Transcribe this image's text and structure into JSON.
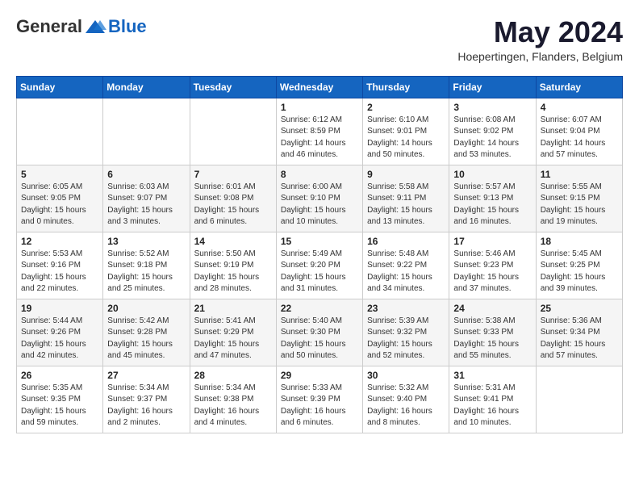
{
  "header": {
    "logo_general": "General",
    "logo_blue": "Blue",
    "month_title": "May 2024",
    "location": "Hoepertingen, Flanders, Belgium"
  },
  "weekdays": [
    "Sunday",
    "Monday",
    "Tuesday",
    "Wednesday",
    "Thursday",
    "Friday",
    "Saturday"
  ],
  "weeks": [
    [
      {
        "day": "",
        "info": ""
      },
      {
        "day": "",
        "info": ""
      },
      {
        "day": "",
        "info": ""
      },
      {
        "day": "1",
        "info": "Sunrise: 6:12 AM\nSunset: 8:59 PM\nDaylight: 14 hours\nand 46 minutes."
      },
      {
        "day": "2",
        "info": "Sunrise: 6:10 AM\nSunset: 9:01 PM\nDaylight: 14 hours\nand 50 minutes."
      },
      {
        "day": "3",
        "info": "Sunrise: 6:08 AM\nSunset: 9:02 PM\nDaylight: 14 hours\nand 53 minutes."
      },
      {
        "day": "4",
        "info": "Sunrise: 6:07 AM\nSunset: 9:04 PM\nDaylight: 14 hours\nand 57 minutes."
      }
    ],
    [
      {
        "day": "5",
        "info": "Sunrise: 6:05 AM\nSunset: 9:05 PM\nDaylight: 15 hours\nand 0 minutes."
      },
      {
        "day": "6",
        "info": "Sunrise: 6:03 AM\nSunset: 9:07 PM\nDaylight: 15 hours\nand 3 minutes."
      },
      {
        "day": "7",
        "info": "Sunrise: 6:01 AM\nSunset: 9:08 PM\nDaylight: 15 hours\nand 6 minutes."
      },
      {
        "day": "8",
        "info": "Sunrise: 6:00 AM\nSunset: 9:10 PM\nDaylight: 15 hours\nand 10 minutes."
      },
      {
        "day": "9",
        "info": "Sunrise: 5:58 AM\nSunset: 9:11 PM\nDaylight: 15 hours\nand 13 minutes."
      },
      {
        "day": "10",
        "info": "Sunrise: 5:57 AM\nSunset: 9:13 PM\nDaylight: 15 hours\nand 16 minutes."
      },
      {
        "day": "11",
        "info": "Sunrise: 5:55 AM\nSunset: 9:15 PM\nDaylight: 15 hours\nand 19 minutes."
      }
    ],
    [
      {
        "day": "12",
        "info": "Sunrise: 5:53 AM\nSunset: 9:16 PM\nDaylight: 15 hours\nand 22 minutes."
      },
      {
        "day": "13",
        "info": "Sunrise: 5:52 AM\nSunset: 9:18 PM\nDaylight: 15 hours\nand 25 minutes."
      },
      {
        "day": "14",
        "info": "Sunrise: 5:50 AM\nSunset: 9:19 PM\nDaylight: 15 hours\nand 28 minutes."
      },
      {
        "day": "15",
        "info": "Sunrise: 5:49 AM\nSunset: 9:20 PM\nDaylight: 15 hours\nand 31 minutes."
      },
      {
        "day": "16",
        "info": "Sunrise: 5:48 AM\nSunset: 9:22 PM\nDaylight: 15 hours\nand 34 minutes."
      },
      {
        "day": "17",
        "info": "Sunrise: 5:46 AM\nSunset: 9:23 PM\nDaylight: 15 hours\nand 37 minutes."
      },
      {
        "day": "18",
        "info": "Sunrise: 5:45 AM\nSunset: 9:25 PM\nDaylight: 15 hours\nand 39 minutes."
      }
    ],
    [
      {
        "day": "19",
        "info": "Sunrise: 5:44 AM\nSunset: 9:26 PM\nDaylight: 15 hours\nand 42 minutes."
      },
      {
        "day": "20",
        "info": "Sunrise: 5:42 AM\nSunset: 9:28 PM\nDaylight: 15 hours\nand 45 minutes."
      },
      {
        "day": "21",
        "info": "Sunrise: 5:41 AM\nSunset: 9:29 PM\nDaylight: 15 hours\nand 47 minutes."
      },
      {
        "day": "22",
        "info": "Sunrise: 5:40 AM\nSunset: 9:30 PM\nDaylight: 15 hours\nand 50 minutes."
      },
      {
        "day": "23",
        "info": "Sunrise: 5:39 AM\nSunset: 9:32 PM\nDaylight: 15 hours\nand 52 minutes."
      },
      {
        "day": "24",
        "info": "Sunrise: 5:38 AM\nSunset: 9:33 PM\nDaylight: 15 hours\nand 55 minutes."
      },
      {
        "day": "25",
        "info": "Sunrise: 5:36 AM\nSunset: 9:34 PM\nDaylight: 15 hours\nand 57 minutes."
      }
    ],
    [
      {
        "day": "26",
        "info": "Sunrise: 5:35 AM\nSunset: 9:35 PM\nDaylight: 15 hours\nand 59 minutes."
      },
      {
        "day": "27",
        "info": "Sunrise: 5:34 AM\nSunset: 9:37 PM\nDaylight: 16 hours\nand 2 minutes."
      },
      {
        "day": "28",
        "info": "Sunrise: 5:34 AM\nSunset: 9:38 PM\nDaylight: 16 hours\nand 4 minutes."
      },
      {
        "day": "29",
        "info": "Sunrise: 5:33 AM\nSunset: 9:39 PM\nDaylight: 16 hours\nand 6 minutes."
      },
      {
        "day": "30",
        "info": "Sunrise: 5:32 AM\nSunset: 9:40 PM\nDaylight: 16 hours\nand 8 minutes."
      },
      {
        "day": "31",
        "info": "Sunrise: 5:31 AM\nSunset: 9:41 PM\nDaylight: 16 hours\nand 10 minutes."
      },
      {
        "day": "",
        "info": ""
      }
    ]
  ]
}
